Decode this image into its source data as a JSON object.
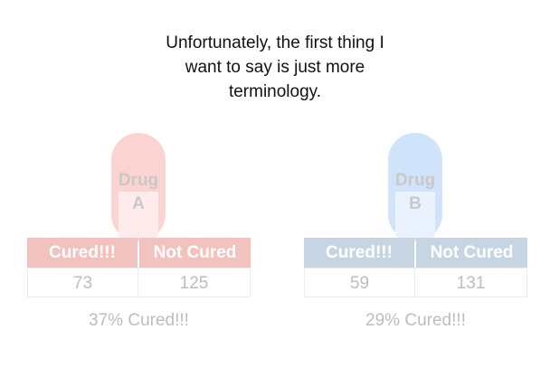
{
  "caption": [
    "Unfortunately, the first thing I",
    "want to say is just more",
    "terminology."
  ],
  "colors": {
    "drug_a_pill": "#fbd4d1",
    "drug_a_header": "#f2c2bf",
    "drug_b_pill": "#cfe4fb",
    "drug_b_header": "#c7d5e3"
  },
  "drugs": [
    {
      "pill_label_line1": "Drug",
      "pill_label_line2": "A",
      "cured_label": "Cured!!!",
      "not_cured_label": "Not Cured",
      "cured_count": "73",
      "not_cured_count": "125",
      "cured_percent_text": "37% Cured!!!"
    },
    {
      "pill_label_line1": "Drug",
      "pill_label_line2": "B",
      "cured_label": "Cured!!!",
      "not_cured_label": "Not Cured",
      "cured_count": "59",
      "not_cured_count": "131",
      "cured_percent_text": "29% Cured!!!"
    }
  ]
}
